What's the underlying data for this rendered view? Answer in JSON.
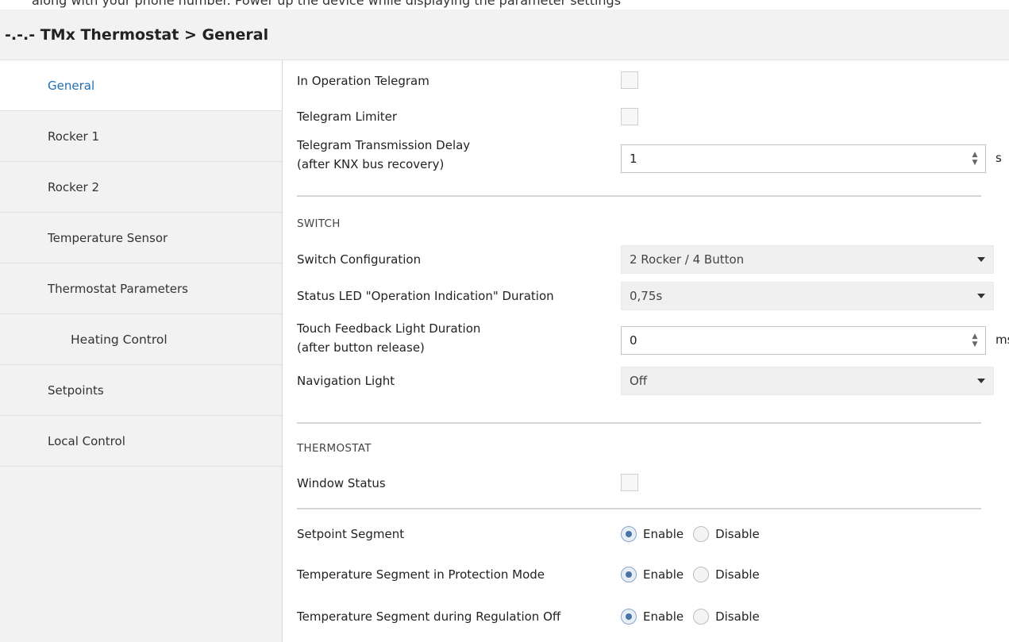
{
  "header": {
    "top_cut_text": "along with your phone number. Power up the device while displaying the parameter settings",
    "title": "-.-.- TMx Thermostat > General"
  },
  "sidebar": {
    "items": [
      {
        "label": "General",
        "active": true
      },
      {
        "label": "Rocker 1"
      },
      {
        "label": "Rocker 2"
      },
      {
        "label": "Temperature Sensor"
      },
      {
        "label": "Thermostat Parameters"
      },
      {
        "label": "Heating Control"
      },
      {
        "label": "Setpoints"
      },
      {
        "label": "Local Control"
      }
    ]
  },
  "general": {
    "in_operation_telegram": "In Operation Telegram",
    "telegram_limiter": "Telegram Limiter",
    "transmission_delay_line1": "Telegram Transmission Delay",
    "transmission_delay_line2": "(after KNX bus recovery)",
    "transmission_delay_value": "1",
    "transmission_delay_unit": "s"
  },
  "switch": {
    "section_title": "SWITCH",
    "config_label": "Switch Configuration",
    "config_value": "2 Rocker / 4 Button",
    "led_label": "Status LED \"Operation Indication\" Duration",
    "led_value": "0,75s",
    "touch_line1": "Touch Feedback Light Duration",
    "touch_line2": "(after button release)",
    "touch_value": "0",
    "touch_unit": "ms",
    "nav_label": "Navigation Light",
    "nav_value": "Off"
  },
  "thermostat": {
    "section_title": "THERMOSTAT",
    "window_status": "Window Status"
  },
  "segments": {
    "enable": "Enable",
    "disable": "Disable",
    "setpoint_label": "Setpoint Segment",
    "protection_label": "Temperature Segment in Protection Mode",
    "regulation_label": "Temperature Segment during Regulation Off"
  },
  "icons": {
    "spin_up": "▲",
    "spin_down": "▼"
  },
  "colors": {
    "accent": "#1f6eb3",
    "radio_selected": "#4a74a6"
  }
}
